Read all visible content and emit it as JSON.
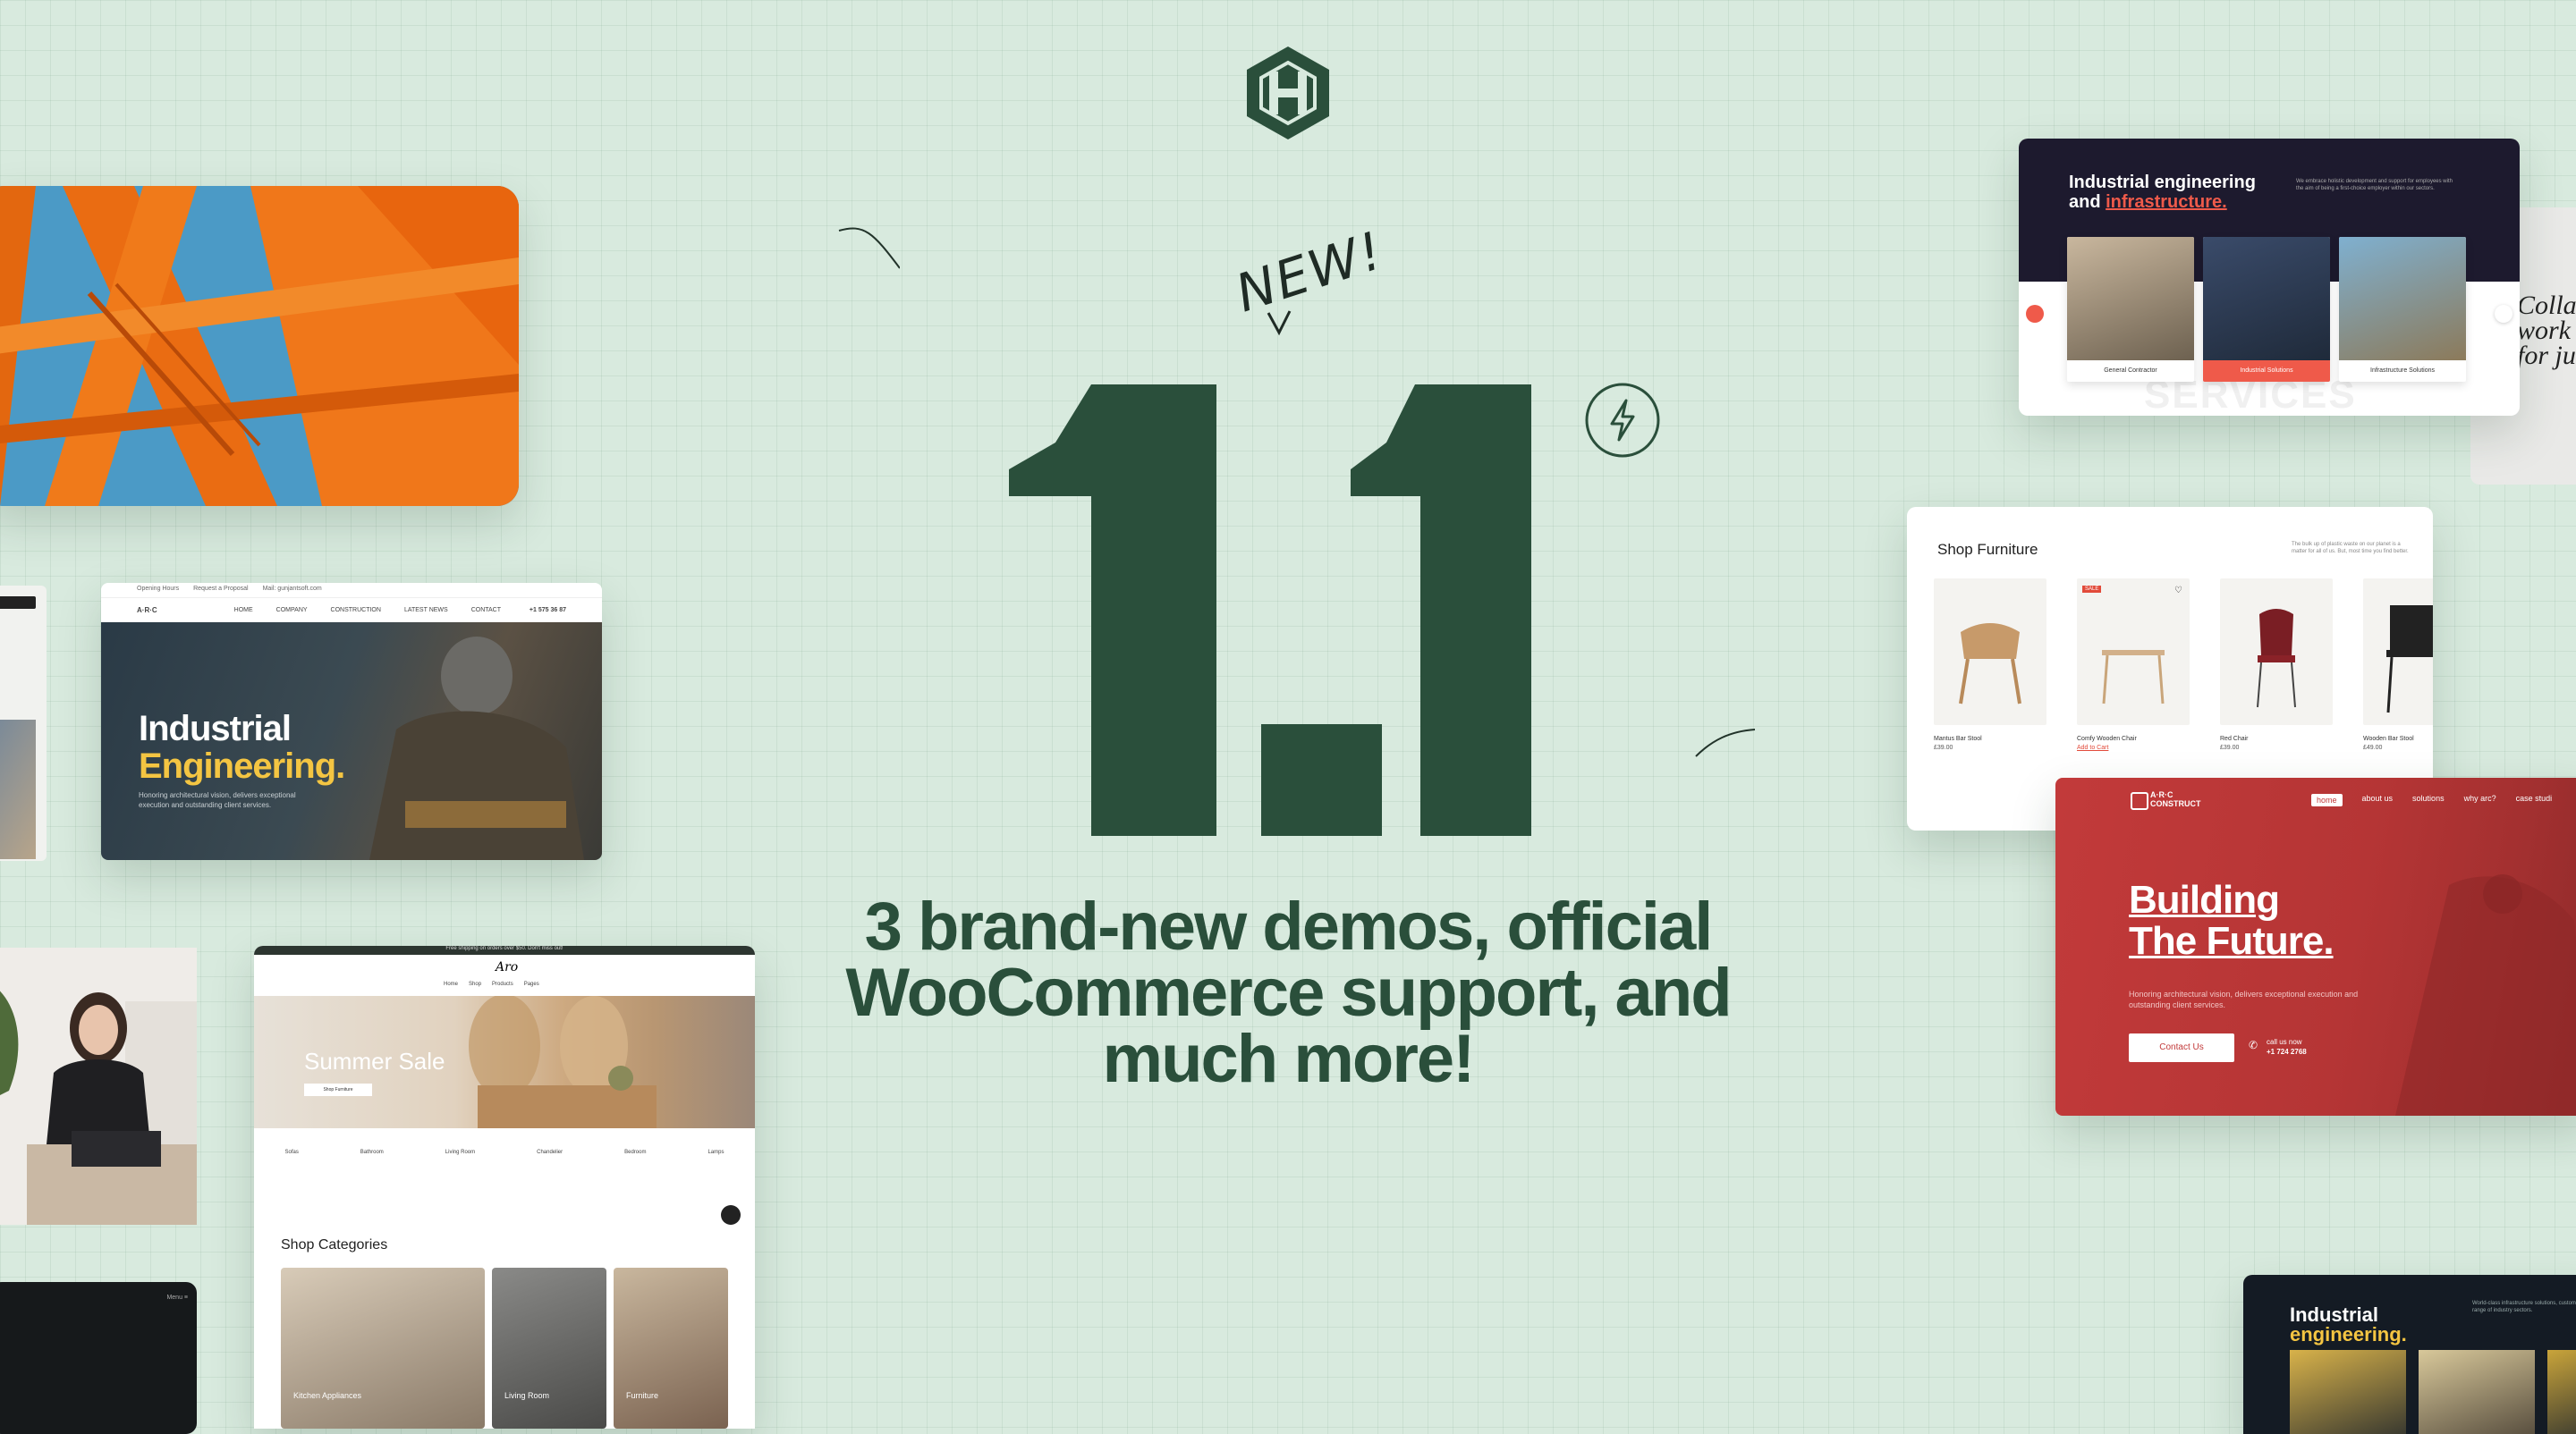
{
  "hero": {
    "new_badge": "NEW!",
    "version": "1.1",
    "tagline_line1": "3 brand-new demos, official",
    "tagline_line2": "WooCommerce support, and",
    "tagline_line3": "much more!"
  },
  "colors": {
    "background": "#d8eade",
    "brand_green": "#2a4f3b",
    "accent_red": "#c23a3a",
    "accent_yellow": "#f4c542"
  },
  "icons": {
    "logo": "hexagon-logo-icon",
    "bolt": "lightning-bolt-icon"
  },
  "industrial_left": {
    "topbar": [
      "Opening Hours",
      "Request a Proposal",
      "Mail: gunjantsoft.com"
    ],
    "nav": [
      "HOME",
      "COMPANY",
      "CONSTRUCTION",
      "LATEST NEWS",
      "CONTACT"
    ],
    "phone": "+1 575 36 87",
    "title_line1": "Industrial",
    "title_line2": "Engineering.",
    "subtitle": "Honoring architectural vision, delivers exceptional execution and outstanding client services."
  },
  "summer_card": {
    "ticker": "Free shipping on orders over $50. Don't miss out!",
    "logo": "Aro",
    "nav": [
      "Home",
      "Shop",
      "Products",
      "Pages"
    ],
    "sale_title": "Summer Sale",
    "sale_button": "Shop Furniture",
    "categories": [
      "Sofas",
      "Bathroom",
      "Living Room",
      "Chandelier",
      "Bedroom",
      "Lamps"
    ],
    "shop_categories": "Shop Categories",
    "tiles": [
      "Kitchen Appliances",
      "Living Room",
      "Furniture"
    ]
  },
  "tr_industrial": {
    "title_line1": "Industrial engineering",
    "title_line2_prefix": "and ",
    "title_line2_highlight": "infrastructure.",
    "description": "We embrace holistic development and support for employees with the aim of being a first-choice employer within our sectors.",
    "tiles": [
      "General Contractor",
      "Industrial Solutions",
      "Infrastructure Solutions"
    ],
    "bg_word": "SERVICES"
  },
  "collab_sliver": {
    "text": "Collab work o for just"
  },
  "furniture": {
    "title": "Shop Furniture",
    "description": "The bulk up of plastic waste on our planet is a matter for all of us. But, most time you find better.",
    "products": [
      {
        "name": "Mantus Bar Stool",
        "price": "£39.00"
      },
      {
        "name": "Comfy Wooden Chair",
        "price": "Add to Cart"
      },
      {
        "name": "Red Chair",
        "price": "£39.00"
      },
      {
        "name": "Wooden Bar Stool",
        "price": "£49.00"
      }
    ],
    "sale_tag": "SALE"
  },
  "build": {
    "brand_line1": "A·R·C",
    "brand_line2": "CONSTRUCT",
    "menu": [
      "home",
      "about us",
      "solutions",
      "why arc?",
      "case studi"
    ],
    "title_line1": "Building",
    "title_line2": "The Future.",
    "subtitle": "Honoring architectural vision, delivers exceptional execution and outstanding client services.",
    "cta": "Contact Us",
    "call_label": "call us now",
    "call_number": "+1 724 2768"
  },
  "br_industrial": {
    "title_line1": "Industrial",
    "title_line2": "engineering.",
    "description": "World-class infrastructure solutions, customers range of industry sectors."
  }
}
